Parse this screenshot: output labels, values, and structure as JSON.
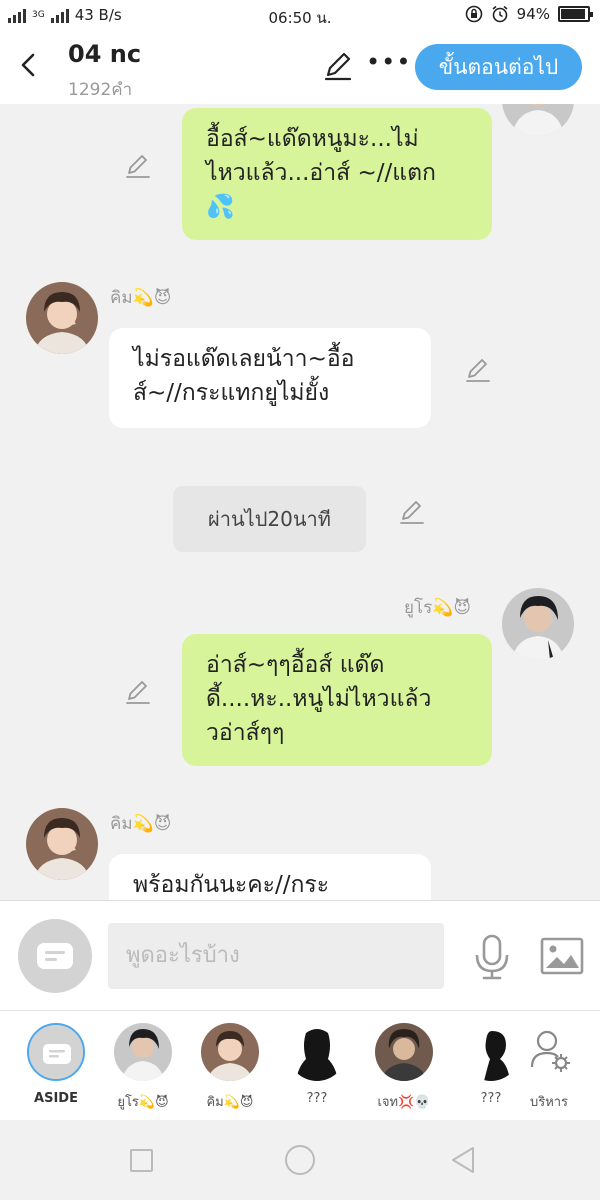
{
  "status_bar": {
    "network": "3G",
    "speed": "43 B/s",
    "time": "06:50 น.",
    "battery": "94%",
    "battery_level": 0.94
  },
  "header": {
    "title": "04 nc",
    "word_count": "1292คำ",
    "next_button": "ขั้นตอนต่อไป"
  },
  "messages": [
    {
      "side": "right",
      "text_lines": [
        "อื้อส์~แด๊ดหนูมะ...ไม่",
        "ไหวแล้ว...อ่าส์ ~//แตก"
      ],
      "emoji": "💦"
    },
    {
      "side": "left",
      "name": "คิม💫😈",
      "text_lines": [
        "ไม่รอแด๊ดเลยน้าา~อื้อ",
        "ส์~//กระแทกยูไม่ยั้ง"
      ]
    },
    {
      "type": "aside",
      "text": "ผ่านไป20นาที"
    },
    {
      "side": "right",
      "name": "ยูโร💫😈",
      "text_lines": [
        "อ่าส์~ๆๆอื้อส์ แด๊ด",
        "ดี้....หะ..หนูไม่ไหวแล้ว",
        "วอ่าส์ๆๆ"
      ]
    },
    {
      "side": "left",
      "name": "คิม💫😈",
      "text_lines": [
        "พร้อมกันนะคะ//กระ"
      ]
    }
  ],
  "input": {
    "placeholder": "พูดอะไรบ้าง"
  },
  "characters": [
    {
      "label": "ASIDE"
    },
    {
      "label": "ยูโร💫😈"
    },
    {
      "label": "คิม💫😈"
    },
    {
      "label": "???"
    },
    {
      "label": "เจท💢💀"
    },
    {
      "label": "???"
    },
    {
      "label": "บริหาร"
    }
  ],
  "colors": {
    "accent": "#4aa8ee",
    "right_bubble": "#d8f49b",
    "left_bubble": "#ffffff",
    "background": "#f1f1f1"
  }
}
